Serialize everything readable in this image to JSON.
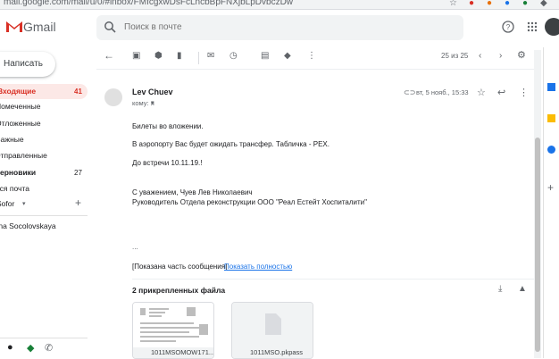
{
  "browser": {
    "url": "mail.google.com/mail/u/0/#inbox/FMfcgxwDsFcLncbBpFNXjbLpDvbczDw"
  },
  "header": {
    "app_name": "Gmail",
    "search_placeholder": "Поиск в почте"
  },
  "sidebar": {
    "compose_label": "Написать",
    "items": [
      {
        "label": "Входящие",
        "count": "41",
        "active": true,
        "bold": true
      },
      {
        "label": "Помеченные",
        "count": ""
      },
      {
        "label": "Отложенные",
        "count": ""
      },
      {
        "label": "Важные",
        "count": ""
      },
      {
        "label": "Отправленные",
        "count": ""
      },
      {
        "label": "Черновики",
        "count": "27",
        "bold": true
      },
      {
        "label": "Вся почта",
        "count": ""
      },
      {
        "label": "Sofor",
        "count": ""
      }
    ],
    "contact": "Ina Socolovskaya"
  },
  "toolbar": {
    "pagination": "25 из 25"
  },
  "message": {
    "sender": "Lev Chuev",
    "to": "кому: я",
    "date": "вт, 5 нояб., 15:33",
    "lines": [
      "Билеты во вложении.",
      "В аэропорту Вас будет ожидать трансфер. Табличка - РЕХ.",
      "До встречи 10.11.19.!",
      "С уважением, Чуев Лев Николаевич",
      "Руководитель Отдела реконструкции  ООО \"Реал Естейт Хоспиталити\""
    ],
    "ellipsis": "...",
    "trimmed_notice": "[Показана часть сообщения]",
    "show_all_link": "Показать полностью"
  },
  "attachments": {
    "title": "2 прикрепленных файла",
    "files": [
      {
        "name": "1011MSOMOW171..."
      },
      {
        "name": "1011MSO.pkpass"
      }
    ]
  },
  "colors": {
    "accent_red": "#d93025",
    "link_blue": "#1a73e8",
    "active_bg": "#fce8e6"
  }
}
